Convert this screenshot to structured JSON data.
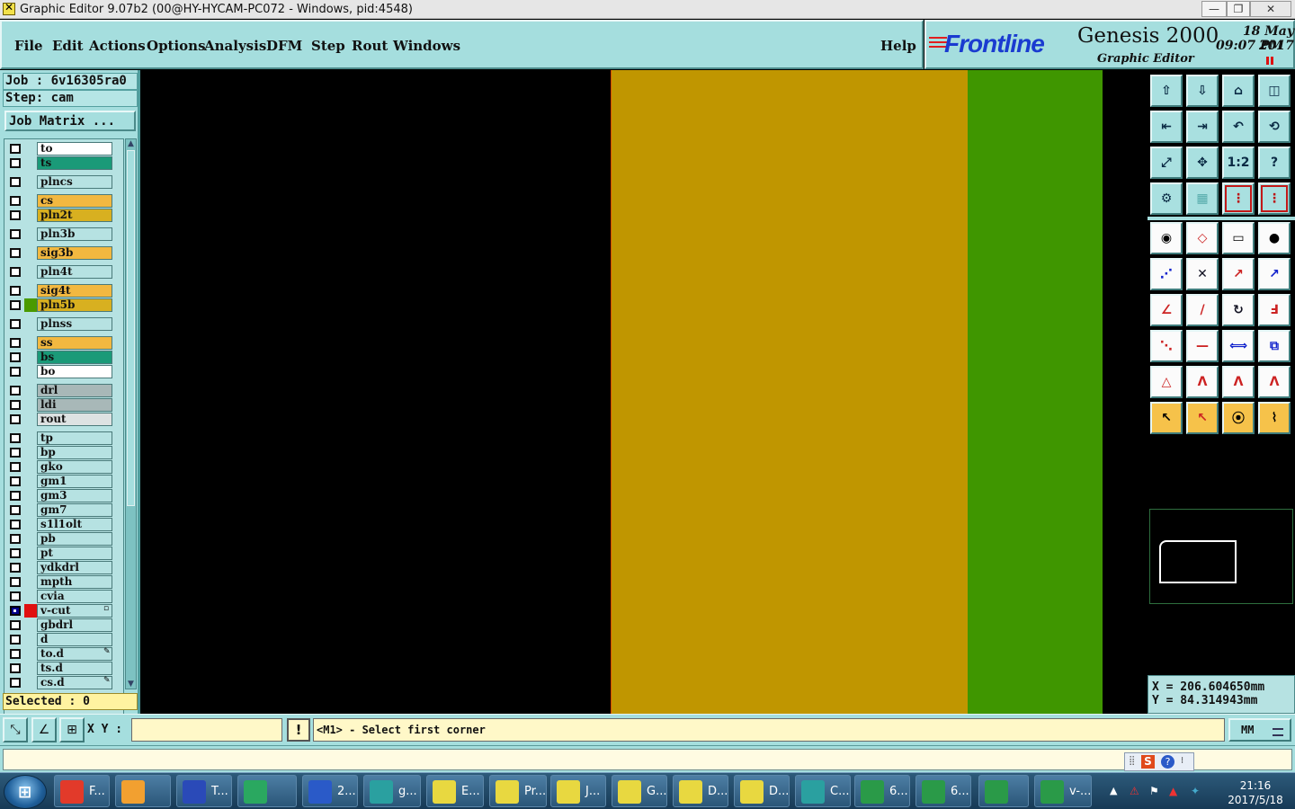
{
  "window": {
    "title": "Graphic Editor 9.07b2 (00@HY-HYCAM-PC072 - Windows, pid:4548)",
    "minimize_glyph": "—",
    "restore_glyph": "❐",
    "close_glyph": "✕"
  },
  "menu": {
    "items": [
      "File",
      "Edit",
      "Actions",
      "Options",
      "Analysis",
      "DFM",
      "Step",
      "Rout",
      "Windows"
    ],
    "help": "Help"
  },
  "brand": {
    "logo": "Frontline",
    "product": "Genesis 2000",
    "subtitle": "Graphic Editor",
    "date": "18 May 2017",
    "time": "09:07 PM"
  },
  "job": {
    "job_line": "Job : 6v16305ra0",
    "step_line": "Step: cam",
    "job_matrix_label": "Job Matrix ..."
  },
  "layers": [
    {
      "name": "to",
      "color": "#ffffff"
    },
    {
      "name": "ts",
      "color": "#1a9a78"
    },
    {
      "name": "plncs",
      "color": "#b6e2e2"
    },
    {
      "name": "cs",
      "color": "#f2b840"
    },
    {
      "name": "pln2t",
      "color": "#d8b020"
    },
    {
      "name": "pln3b",
      "color": "#b6e2e2"
    },
    {
      "name": "sig3b",
      "color": "#f2b840"
    },
    {
      "name": "pln4t",
      "color": "#b6e2e2"
    },
    {
      "name": "sig4t",
      "color": "#f2b840"
    },
    {
      "name": "pln5b",
      "color": "#d8b020",
      "swatch": "#4a9a00"
    },
    {
      "name": "plnss",
      "color": "#b6e2e2"
    },
    {
      "name": "ss",
      "color": "#f2b840"
    },
    {
      "name": "bs",
      "color": "#1a9a78"
    },
    {
      "name": "bo",
      "color": "#ffffff"
    },
    {
      "name": "drl",
      "color": "#a8b8b8"
    },
    {
      "name": "ldi",
      "color": "#a8b8b8"
    },
    {
      "name": "rout",
      "color": "#dde2e2"
    },
    {
      "name": "tp",
      "color": "#b6e2e2"
    },
    {
      "name": "bp",
      "color": "#b6e2e2"
    },
    {
      "name": "gko",
      "color": "#b6e2e2"
    },
    {
      "name": "gm1",
      "color": "#b6e2e2"
    },
    {
      "name": "gm3",
      "color": "#b6e2e2"
    },
    {
      "name": "gm7",
      "color": "#b6e2e2"
    },
    {
      "name": "s1l1olt",
      "color": "#b6e2e2"
    },
    {
      "name": "pb",
      "color": "#b6e2e2"
    },
    {
      "name": "pt",
      "color": "#b6e2e2"
    },
    {
      "name": "ydkdrl",
      "color": "#b6e2e2"
    },
    {
      "name": "mpth",
      "color": "#b6e2e2"
    },
    {
      "name": "cvia",
      "color": "#b6e2e2"
    },
    {
      "name": "v-cut",
      "color": "#b6e2e2",
      "swatch": "#e01010",
      "checked": true,
      "mark": "▫"
    },
    {
      "name": "gbdrl",
      "color": "#b6e2e2"
    },
    {
      "name": "d",
      "color": "#b6e2e2"
    },
    {
      "name": "to.d",
      "color": "#b6e2e2",
      "mark": "✎"
    },
    {
      "name": "ts.d",
      "color": "#b6e2e2"
    },
    {
      "name": "cs.d",
      "color": "#b6e2e2",
      "mark": "✎"
    }
  ],
  "selected_label": "Selected : 0",
  "canvas": {
    "bands": [
      {
        "name": "gold-layer-region",
        "color": "#c09600"
      },
      {
        "name": "green-layer-region",
        "color": "#3f9600"
      }
    ]
  },
  "toolbar": {
    "icons": [
      "zoom-home-icon",
      "zoom-window-icon",
      "home-view-icon",
      "split-view-icon",
      "pan-left-icon",
      "pan-right-icon",
      "undo-zoom-icon",
      "redraw-icon",
      "fit-all-icon",
      "fit-center-icon",
      "ratio-1-2-icon",
      "query-icon",
      "settings-icon",
      "grid-icon",
      "snap-on-icon",
      "snap-off-icon",
      "pad-tool-icon",
      "surface-tool-icon",
      "ruler-icon",
      "circle-tool-icon",
      "node-tool-icon",
      "cross-tool-icon",
      "line-arrow-icon",
      "line-dot-icon",
      "angle-tool-icon",
      "diagonal-tool-icon",
      "arc-tool-icon",
      "mirror-text-icon",
      "move-tool-icon",
      "minus-tool-icon",
      "dimension-tool-icon",
      "shapes-tool-icon",
      "triangle-tool-icon",
      "arch-tool-icon",
      "arch-red-icon",
      "arch-blue-icon",
      "pointer-icon",
      "select-pointer-icon",
      "rotate-select-icon",
      "route-tool-icon"
    ],
    "ratio_text": "1:2",
    "query_text": "?"
  },
  "coords": {
    "x": "X = 206.604650mm",
    "y": "Y = 84.314943mm"
  },
  "bottom": {
    "xy_label": "X Y :",
    "xy_value": "",
    "exclaim": "!",
    "prompt": "<M1> - Select first corner",
    "units": "MM"
  },
  "taskbar": {
    "tasks": [
      {
        "label": "F...",
        "color": "#e23a2a"
      },
      {
        "label": "",
        "color": "#f2a030"
      },
      {
        "label": "T...",
        "color": "#2a4ab8"
      },
      {
        "label": "",
        "color": "#2aa860"
      },
      {
        "label": "2...",
        "color": "#2a5ac8"
      },
      {
        "label": "g...",
        "color": "#2aa0a0"
      },
      {
        "label": "E...",
        "color": "#e8d840"
      },
      {
        "label": "Pr...",
        "color": "#e8d840"
      },
      {
        "label": "J...",
        "color": "#e8d840"
      },
      {
        "label": "G...",
        "color": "#e8d840"
      },
      {
        "label": "D...",
        "color": "#e8d840"
      },
      {
        "label": "D...",
        "color": "#e8d840"
      },
      {
        "label": "C...",
        "color": "#2aa0a0"
      },
      {
        "label": "6...",
        "color": "#2a9a48"
      },
      {
        "label": "6...",
        "color": "#2a9a48"
      },
      {
        "label": "",
        "color": "#2a9a48"
      },
      {
        "label": "v-...",
        "color": "#2a9a48"
      }
    ],
    "clock_time": "21:16",
    "clock_date": "2017/5/18"
  }
}
